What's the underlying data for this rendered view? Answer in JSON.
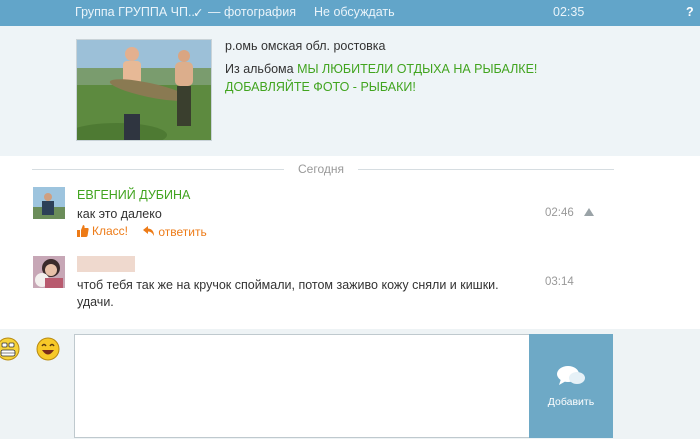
{
  "topbar": {
    "group_label": "Группа ГРУППА ЧП...",
    "check_mark": "✓",
    "photo_label": "— фотография",
    "discuss_label": "Не обсуждать",
    "time": "02:35",
    "help": "?"
  },
  "post": {
    "user": "р.омь омская обл. ростовка",
    "album_prefix": "Из альбома",
    "album_name_line1": "МЫ ЛЮБИТЕЛИ ОТДЫХА НА РЫБАЛКЕ!",
    "album_name_line2": "ДОБАВЛЯЙТЕ ФОТО - РЫБАКИ!"
  },
  "separator": {
    "label": "Сегодня"
  },
  "messages": [
    {
      "author": "ЕВГЕНИЙ ДУБИНА",
      "text": "как это далеко",
      "like_label": "Класс!",
      "reply_label": "ответить",
      "time": "02:46"
    },
    {
      "author": "",
      "text_line1": "чтоб тебя так же на кручок споймали, потом заживо кожу сняли и кишки.",
      "text_line2": "удачи.",
      "time": "03:14"
    }
  ],
  "composer": {
    "send_label": "Добавить",
    "value": "",
    "smileys": [
      "grin-emoji-icon",
      "laughing-emoji-icon"
    ]
  },
  "colors": {
    "topbar": "#62a5c9",
    "green_link": "#41a41f",
    "orange_action": "#ed7b17",
    "send_button": "#6ea9c6"
  }
}
